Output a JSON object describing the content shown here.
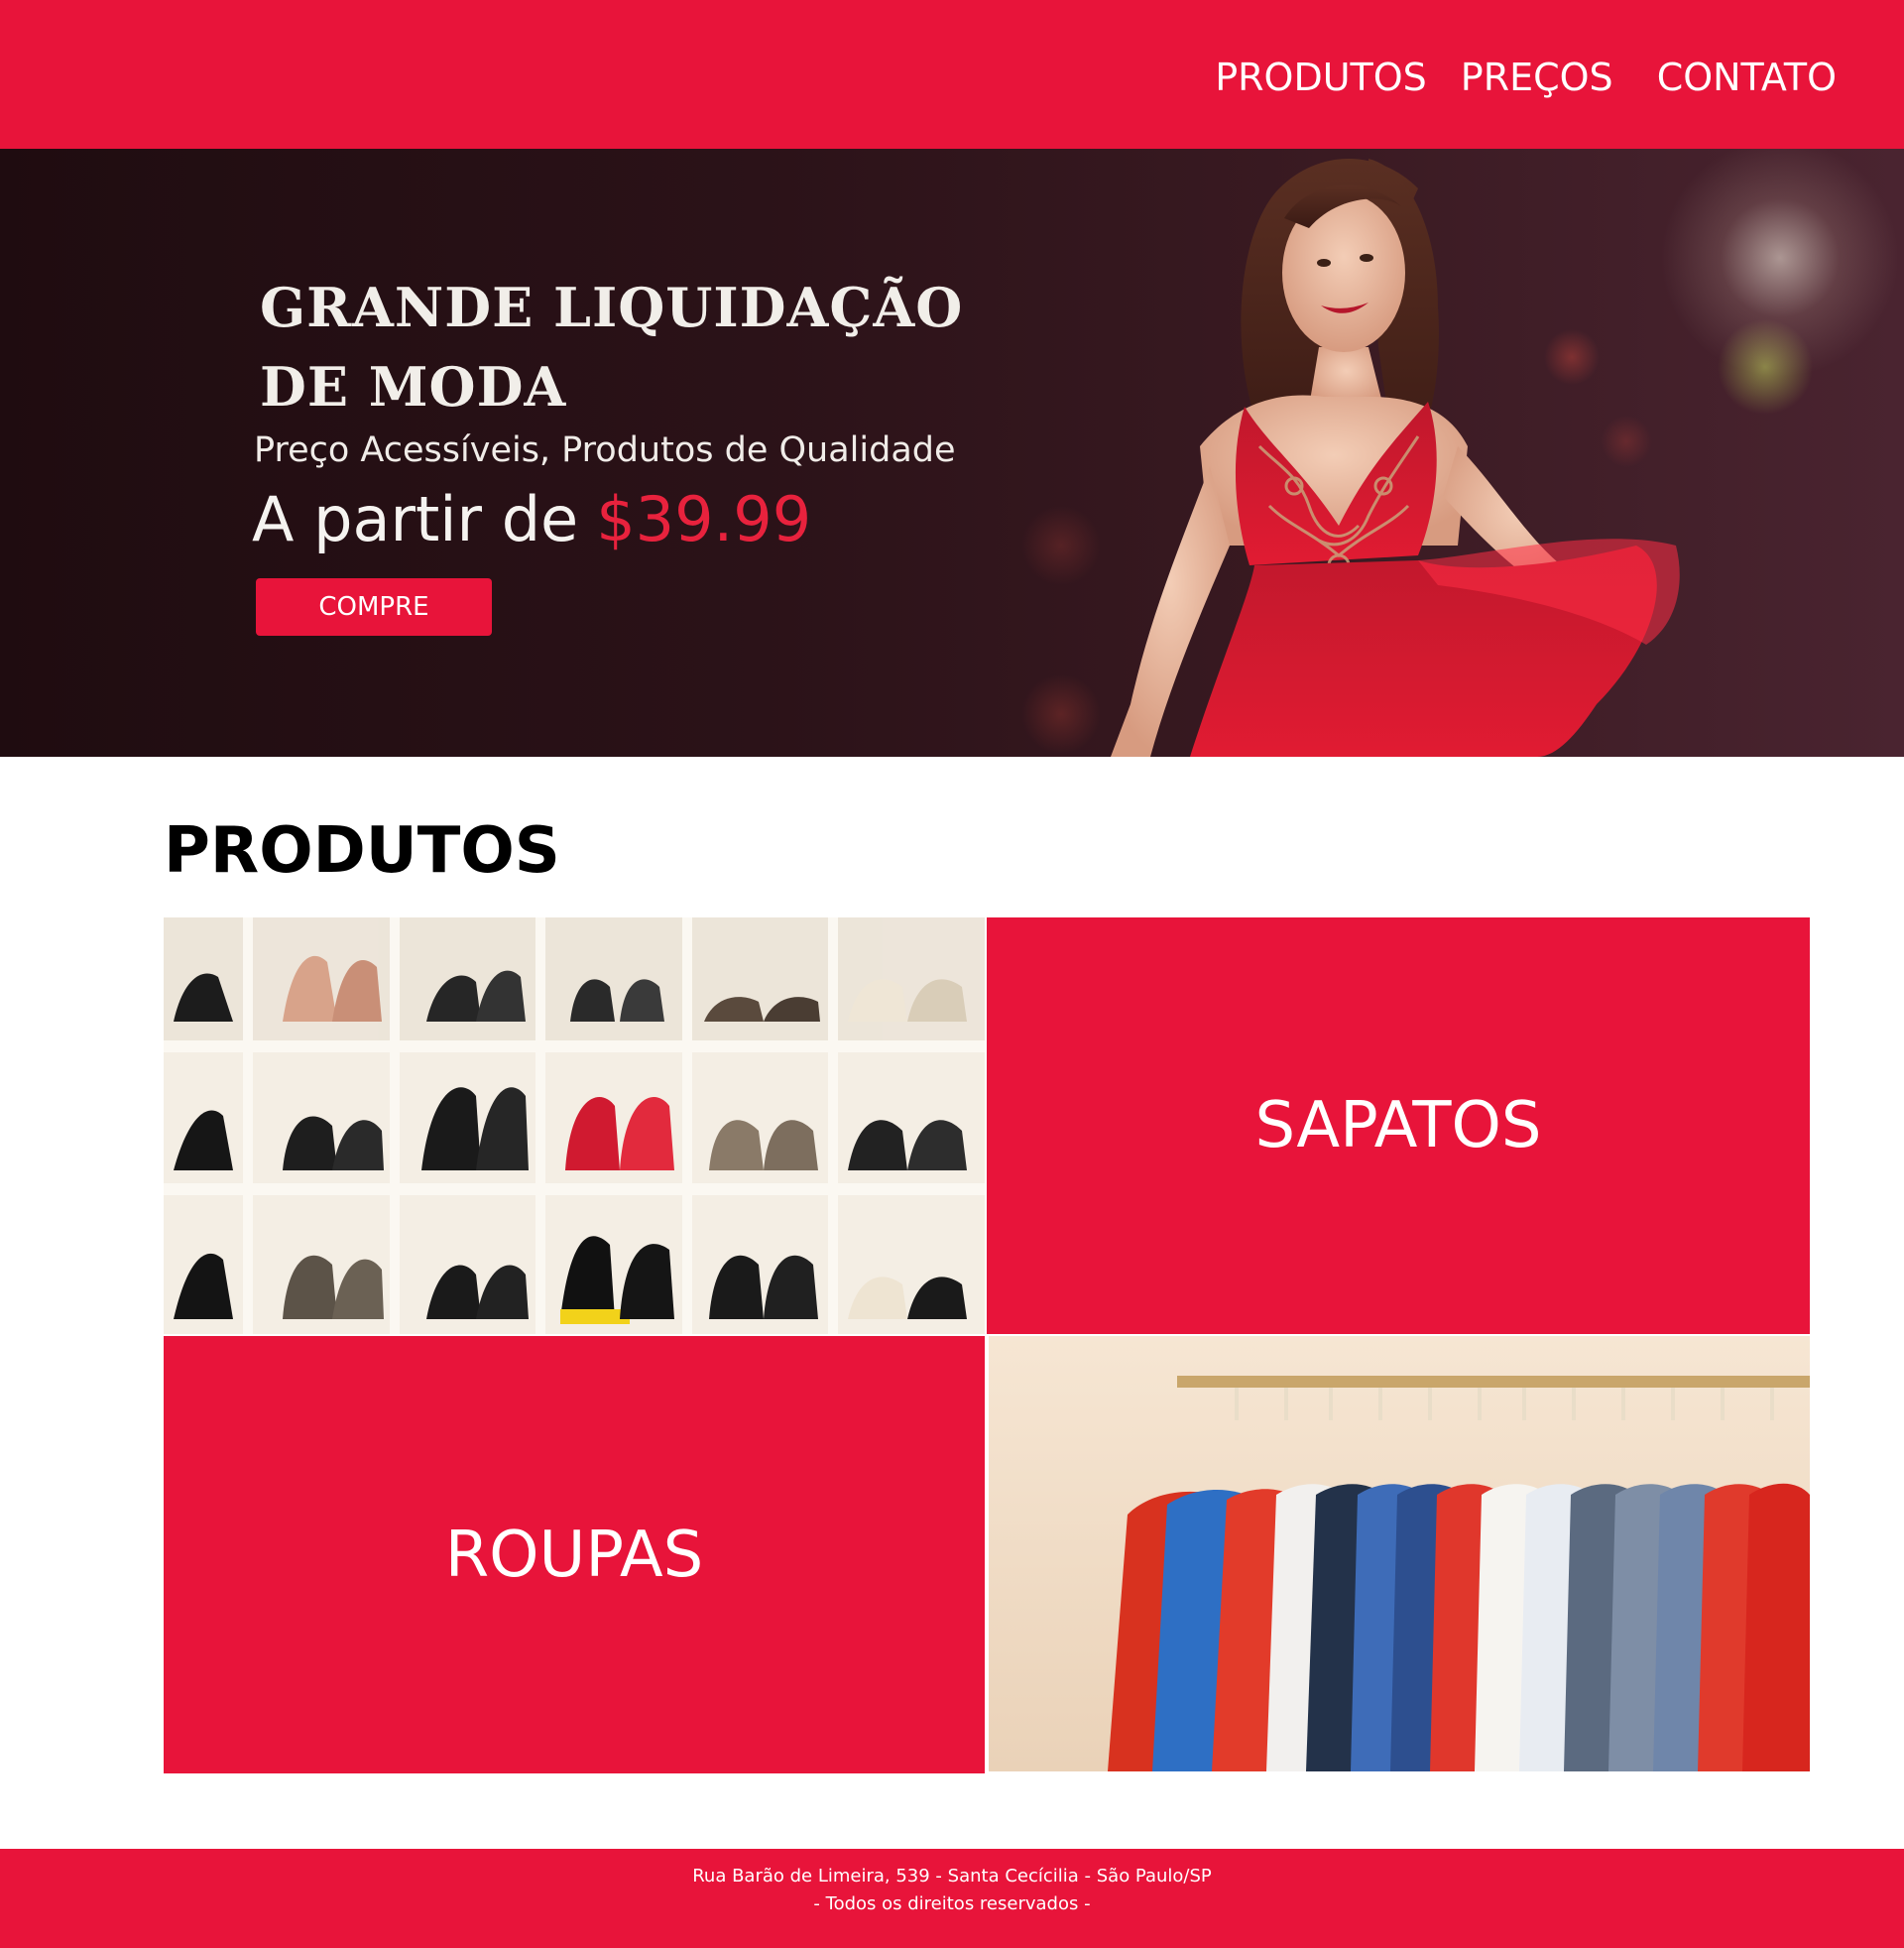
{
  "nav": {
    "items": [
      {
        "label": "PRODUTOS"
      },
      {
        "label": "PREÇOS"
      },
      {
        "label": "CONTATO"
      }
    ]
  },
  "hero": {
    "title_line1": "GRANDE LIQUIDAÇÃO",
    "title_line2": "DE MODA",
    "subtitle": "Preço Acessíveis, Produtos de Qualidade",
    "price_prefix": "A partir de",
    "price": "$39.99",
    "button_label": "COMPRE"
  },
  "products": {
    "title": "PRODUTOS",
    "tiles": [
      {
        "label": "SAPATOS"
      },
      {
        "label": "ROUPAS"
      }
    ]
  },
  "footer": {
    "address": "Rua Barão de Limeira, 539 - Santa Cecícilia - São Paulo/SP",
    "rights": "- Todos os direitos reservados -"
  },
  "colors": {
    "brand_red": "#e8143a",
    "hero_dark": "#2b1218",
    "white": "#ffffff"
  }
}
